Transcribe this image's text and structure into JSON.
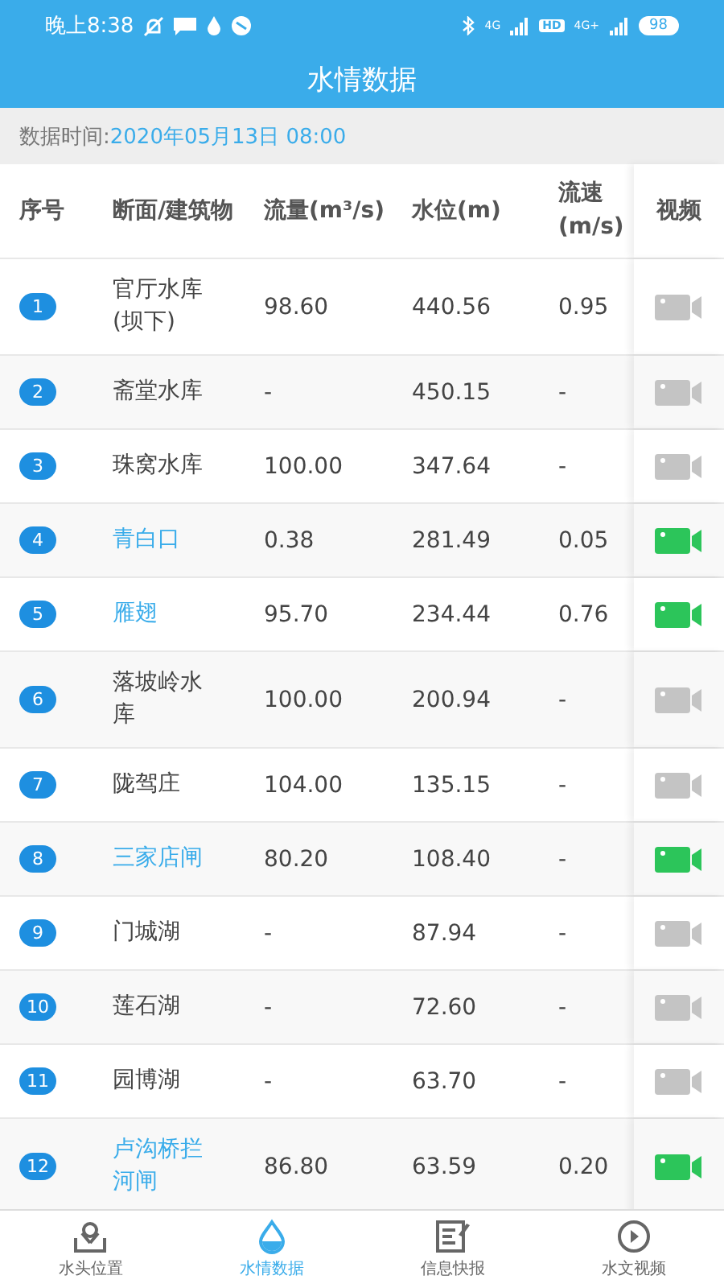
{
  "status_bar": {
    "time": "晚上8:38",
    "network_1": "4G",
    "hd": "HD",
    "network_2": "4G+",
    "battery": "98"
  },
  "title": "水情数据",
  "data_time": {
    "label": "数据时间:",
    "value": "2020年05月13日 08:00"
  },
  "table": {
    "columns": [
      "序号",
      "断面/建筑物",
      "流量(m³/s)",
      "水位(m)",
      "流速(m/s)",
      "视频"
    ],
    "rows": [
      {
        "index": "1",
        "name": "官厅水库(坝下)",
        "flow": "98.60",
        "level": "440.56",
        "speed": "0.95",
        "has_video": false
      },
      {
        "index": "2",
        "name": "斋堂水库",
        "flow": "-",
        "level": "450.15",
        "speed": "-",
        "has_video": false
      },
      {
        "index": "3",
        "name": "珠窝水库",
        "flow": "100.00",
        "level": "347.64",
        "speed": "-",
        "has_video": false
      },
      {
        "index": "4",
        "name": "青白口",
        "flow": "0.38",
        "level": "281.49",
        "speed": "0.05",
        "has_video": true
      },
      {
        "index": "5",
        "name": "雁翅",
        "flow": "95.70",
        "level": "234.44",
        "speed": "0.76",
        "has_video": true
      },
      {
        "index": "6",
        "name": "落坡岭水库",
        "flow": "100.00",
        "level": "200.94",
        "speed": "-",
        "has_video": false
      },
      {
        "index": "7",
        "name": "陇驾庄",
        "flow": "104.00",
        "level": "135.15",
        "speed": "-",
        "has_video": false
      },
      {
        "index": "8",
        "name": "三家店闸",
        "flow": "80.20",
        "level": "108.40",
        "speed": "-",
        "has_video": true
      },
      {
        "index": "9",
        "name": "门城湖",
        "flow": "-",
        "level": "87.94",
        "speed": "-",
        "has_video": false
      },
      {
        "index": "10",
        "name": "莲石湖",
        "flow": "-",
        "level": "72.60",
        "speed": "-",
        "has_video": false
      },
      {
        "index": "11",
        "name": "园博湖",
        "flow": "-",
        "level": "63.70",
        "speed": "-",
        "has_video": false
      },
      {
        "index": "12",
        "name": "卢沟桥拦河闸",
        "flow": "86.80",
        "level": "63.59",
        "speed": "0.20",
        "has_video": true
      }
    ]
  },
  "bottom_nav": [
    {
      "kind": "location",
      "label": "水头位置",
      "selected": false
    },
    {
      "kind": "water",
      "label": "水情数据",
      "selected": true
    },
    {
      "kind": "news",
      "label": "信息快报",
      "selected": false
    },
    {
      "kind": "video",
      "label": "水文视频",
      "selected": false
    }
  ]
}
